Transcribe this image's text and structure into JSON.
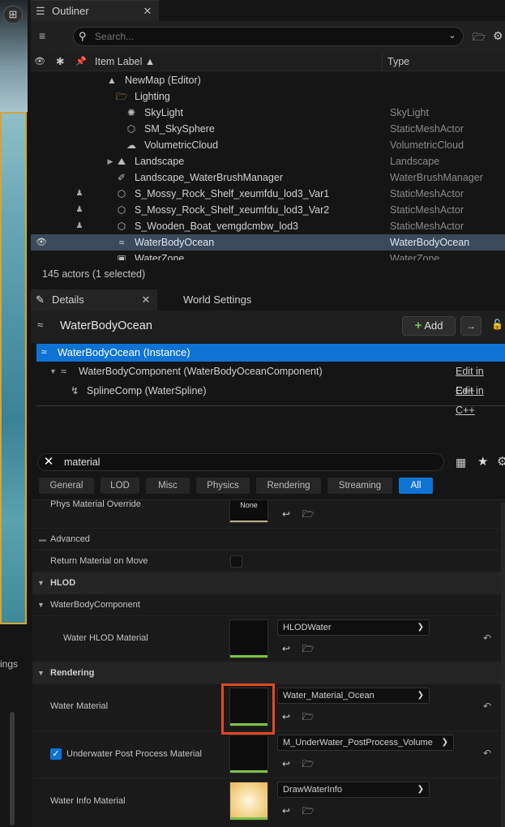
{
  "viewport": {
    "settings_text": "ings",
    "toolbar_icon": "viewport-options-icon"
  },
  "outliner": {
    "tab_title": "Outliner",
    "search_placeholder": "Search...",
    "columns": {
      "label": "Item Label ▲",
      "type": "Type"
    },
    "rows": [
      {
        "label": "NewMap (Editor)",
        "type": "",
        "icon": "map-icon"
      },
      {
        "label": "Lighting",
        "type": "",
        "icon": "folder-icon"
      },
      {
        "label": "SkyLight",
        "type": "SkyLight",
        "icon": "skylight-icon"
      },
      {
        "label": "SM_SkySphere",
        "type": "StaticMeshActor",
        "icon": "static-mesh-icon"
      },
      {
        "label": "VolumetricCloud",
        "type": "VolumetricCloud",
        "icon": "cloud-icon"
      },
      {
        "label": "Landscape",
        "type": "Landscape",
        "icon": "landscape-icon"
      },
      {
        "label": "Landscape_WaterBrushManager",
        "type": "WaterBrushManager",
        "icon": "water-brush-icon"
      },
      {
        "label": "S_Mossy_Rock_Shelf_xeumfdu_lod3_Var1",
        "type": "StaticMeshActor",
        "icon": "static-mesh-icon"
      },
      {
        "label": "S_Mossy_Rock_Shelf_xeumfdu_lod3_Var2",
        "type": "StaticMeshActor",
        "icon": "static-mesh-icon"
      },
      {
        "label": "S_Wooden_Boat_vemgdcmbw_lod3",
        "type": "StaticMeshActor",
        "icon": "static-mesh-icon"
      },
      {
        "label": "WaterBodyOcean",
        "type": "WaterBodyOcean",
        "icon": "water-body-icon",
        "selected": true
      },
      {
        "label": "WaterZone",
        "type": "WaterZone",
        "icon": "water-zone-icon"
      }
    ],
    "actor_count": "145 actors (1 selected)"
  },
  "details": {
    "tab_title": "Details",
    "world_settings_tab": "World Settings",
    "object_name": "WaterBodyOcean",
    "add_label": "Add",
    "components": {
      "instance": "WaterBodyOcean (Instance)",
      "water_body_component": "WaterBodyComponent (WaterBodyOceanComponent)",
      "spline_comp": "SplineComp (WaterSpline)",
      "edit_cpp": "Edit in C++"
    },
    "filter_value": "material",
    "categories": [
      "General",
      "LOD",
      "Misc",
      "Physics",
      "Rendering",
      "Streaming",
      "All"
    ],
    "active_category": "All",
    "properties": {
      "phys_material_override": "Phys Material Override",
      "phys_thumb_text": "None",
      "advanced": "Advanced",
      "return_material_on_move": "Return Material on Move",
      "hlod_category": "HLOD",
      "water_body_component_category": "WaterBodyComponent",
      "water_hlod_material": "Water HLOD Material",
      "water_hlod_value": "HLODWater",
      "rendering_category": "Rendering",
      "water_material": "Water Material",
      "water_material_value": "Water_Material_Ocean",
      "underwater_pp_material": "Underwater Post Process Material",
      "underwater_pp_value": "M_UnderWater_PostProcess_Volume",
      "water_info_material": "Water Info Material",
      "water_info_value": "DrawWaterInfo"
    }
  },
  "colors": {
    "selection_blue": "#0f73d6",
    "highlight_orange": "#e04a21",
    "asset_green": "#7cc242"
  }
}
